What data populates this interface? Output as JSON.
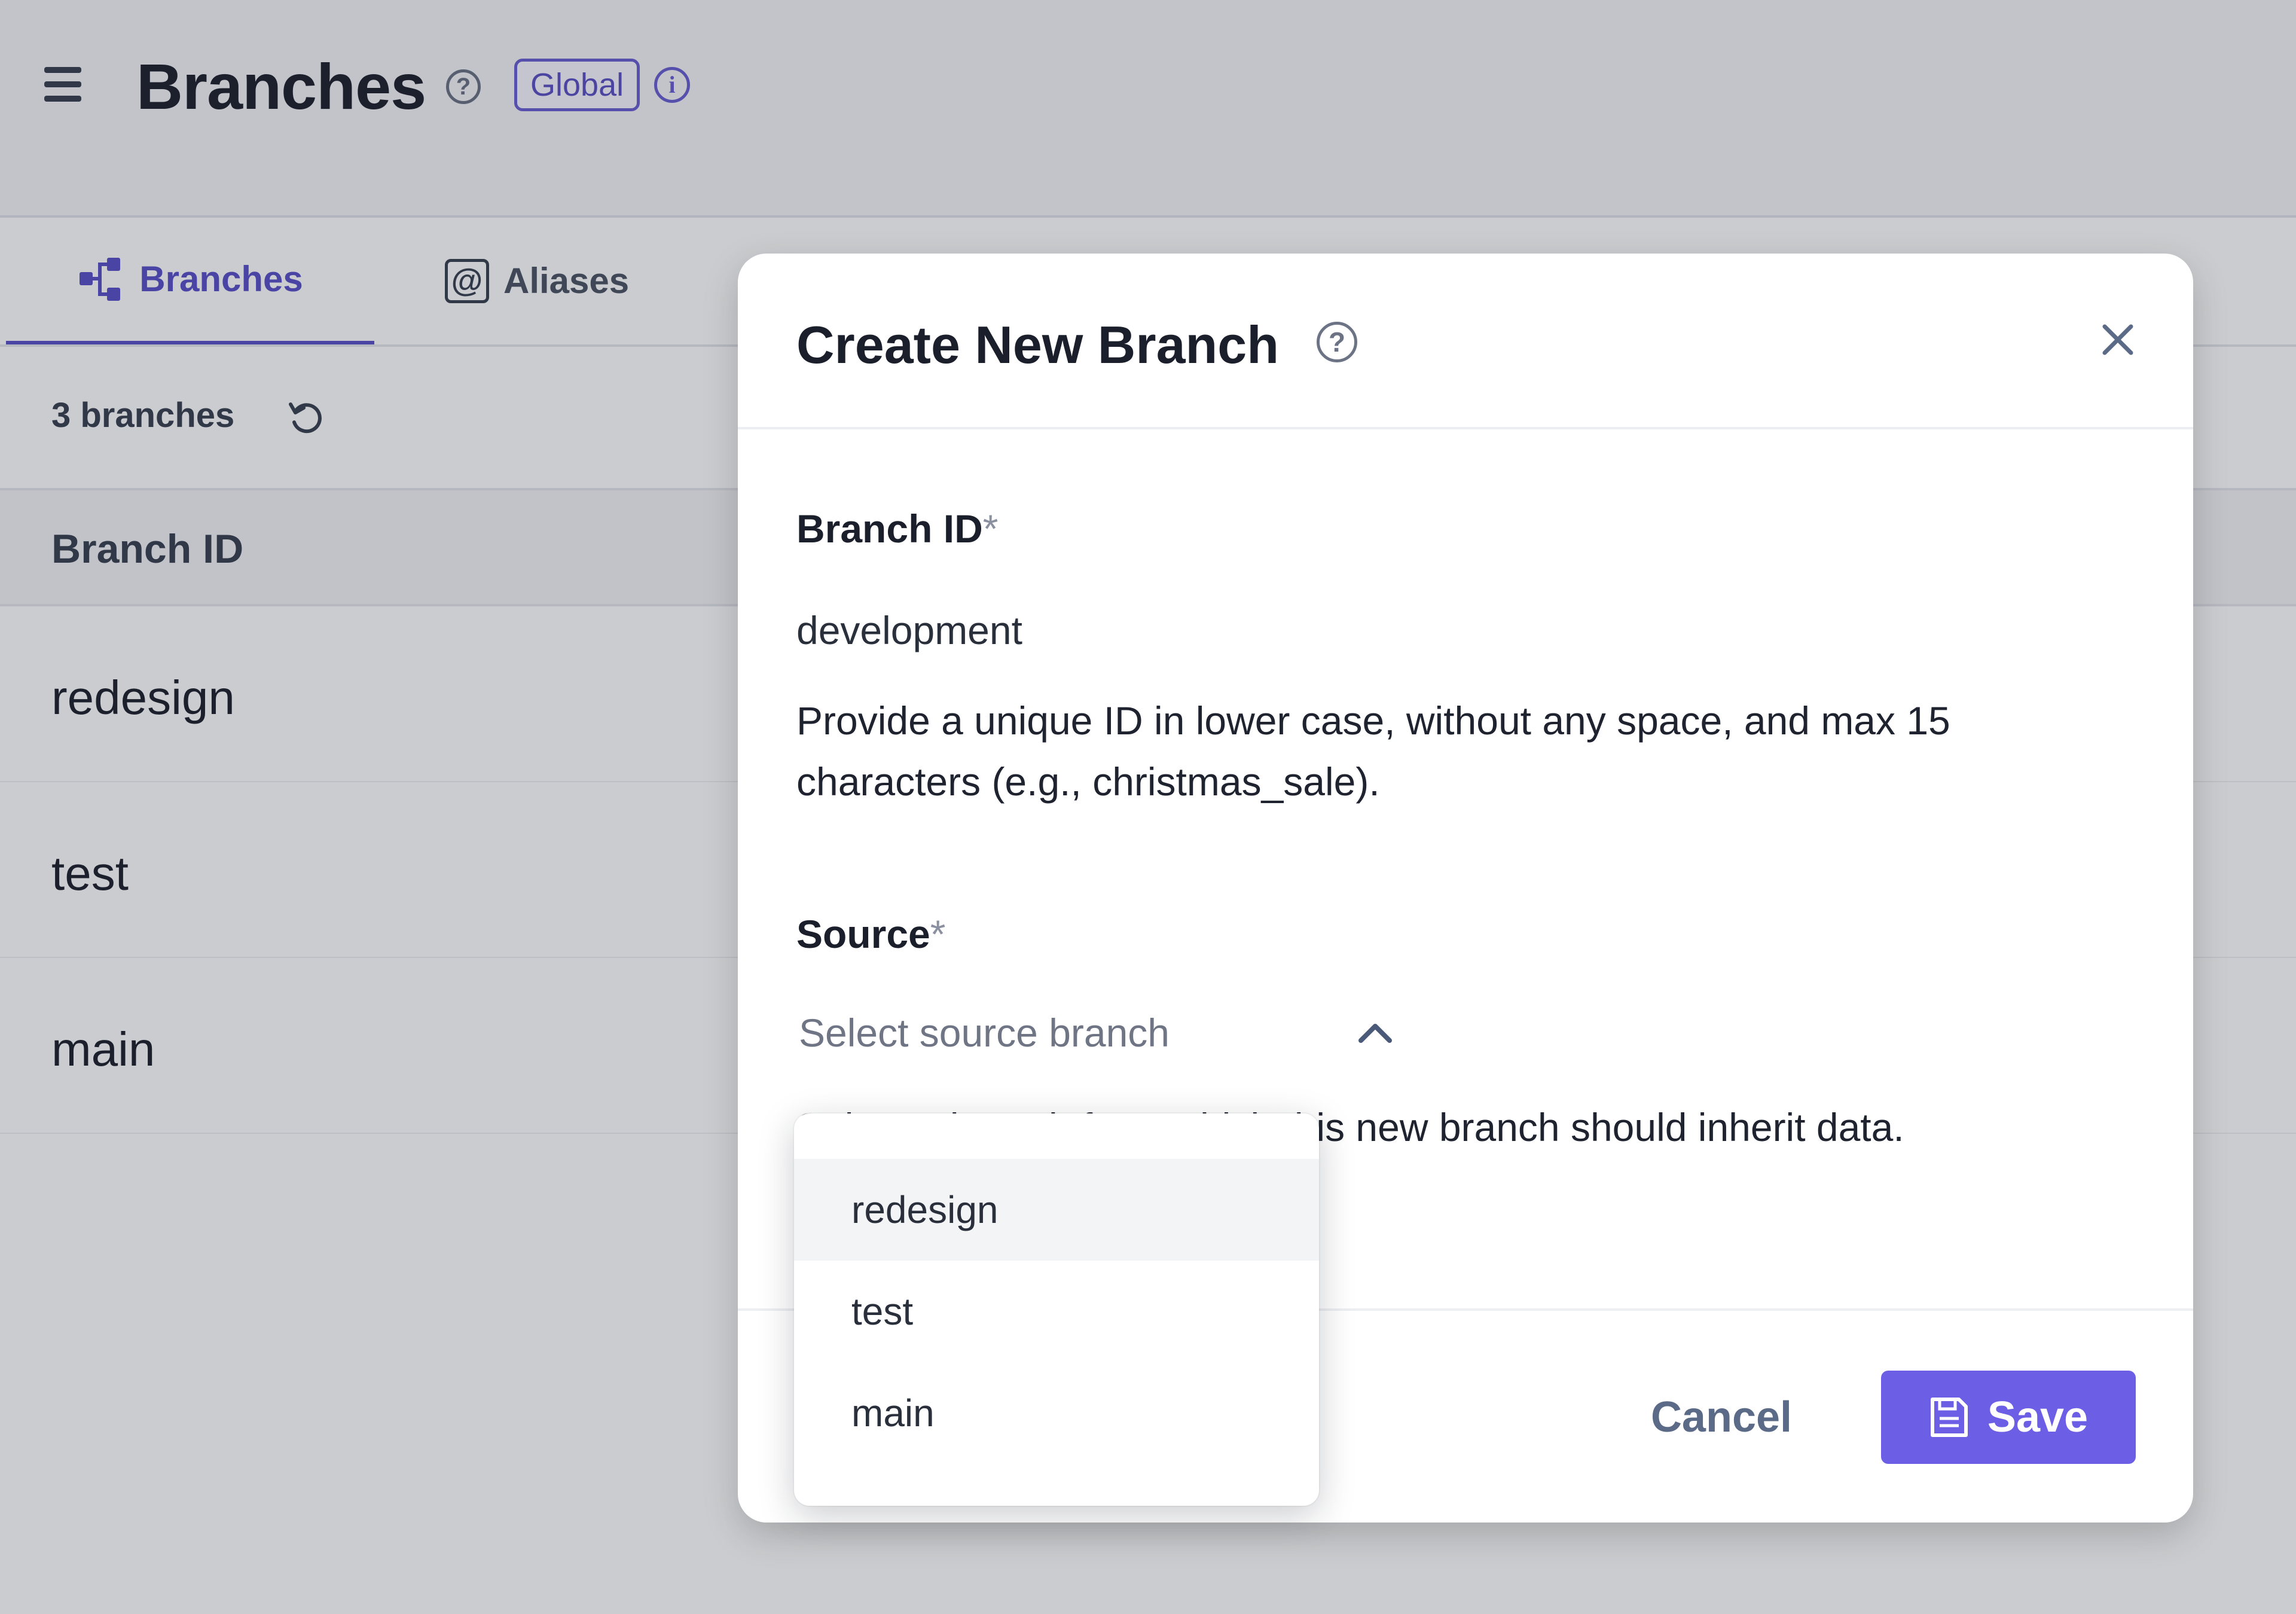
{
  "header": {
    "title": "Branches",
    "badge": "Global",
    "info_glyph": "i",
    "help_glyph": "?"
  },
  "tabs": [
    {
      "label": "Branches",
      "icon": "branches-icon",
      "active": true
    },
    {
      "label": "Aliases",
      "icon": "at-sign-icon",
      "active": false
    }
  ],
  "alias_glyph": "@",
  "branch_count": "3 branches",
  "table": {
    "header": "Branch ID",
    "rows": [
      "redesign",
      "test",
      "main"
    ]
  },
  "modal": {
    "title": "Create New Branch",
    "help_glyph": "?",
    "branch_id": {
      "label": "Branch ID",
      "required_mark": "*",
      "value": "development",
      "helper": "Provide a unique ID in lower case, without any space, and max 15 characters (e.g., christmas_sale)."
    },
    "source": {
      "label": "Source",
      "required_mark": "*",
      "placeholder": "Select source branch",
      "helper": "Select a branch from which this new branch should inherit data.",
      "options": [
        "redesign",
        "test",
        "main"
      ],
      "highlighted_option": "redesign",
      "open": true
    },
    "cancel_label": "Cancel",
    "save_label": "Save"
  },
  "colors": {
    "accent": "#6c5fe6",
    "tab_active": "#5a52c8",
    "text_primary": "#1f2330",
    "text_muted": "#6f7584"
  }
}
